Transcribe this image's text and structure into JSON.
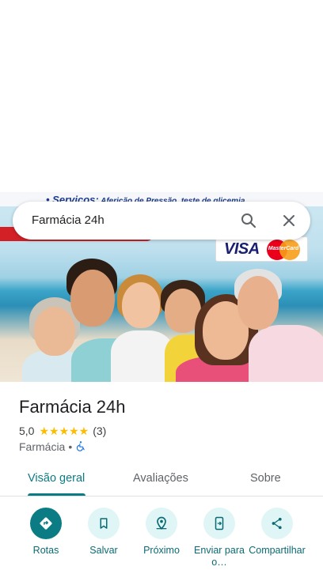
{
  "search": {
    "query": "Farmácia 24h"
  },
  "photo": {
    "banner_text": "• Serviços:",
    "banner_subtext": " Aferição de Pressão, teste de glicemia",
    "card_brands": [
      "VISA",
      "MasterCard"
    ]
  },
  "place": {
    "name": "Farmácia 24h",
    "rating": "5,0",
    "stars": "★★★★★",
    "review_count": "(3)",
    "category": "Farmácia",
    "separator": "•"
  },
  "tabs": [
    {
      "label": "Visão geral",
      "active": true
    },
    {
      "label": "Avaliações",
      "active": false
    },
    {
      "label": "Sobre",
      "active": false
    }
  ],
  "actions": [
    {
      "label": "Rotas",
      "icon": "directions-icon"
    },
    {
      "label": "Salvar",
      "icon": "bookmark-icon"
    },
    {
      "label": "Próximo",
      "icon": "nearby-icon"
    },
    {
      "label": "Enviar para o…",
      "icon": "send-to-phone-icon"
    },
    {
      "label": "Compartilhar",
      "icon": "share-icon"
    }
  ],
  "colors": {
    "accent": "#0b7c84",
    "action_bg": "#dff5f6",
    "star": "#fbbc04"
  }
}
